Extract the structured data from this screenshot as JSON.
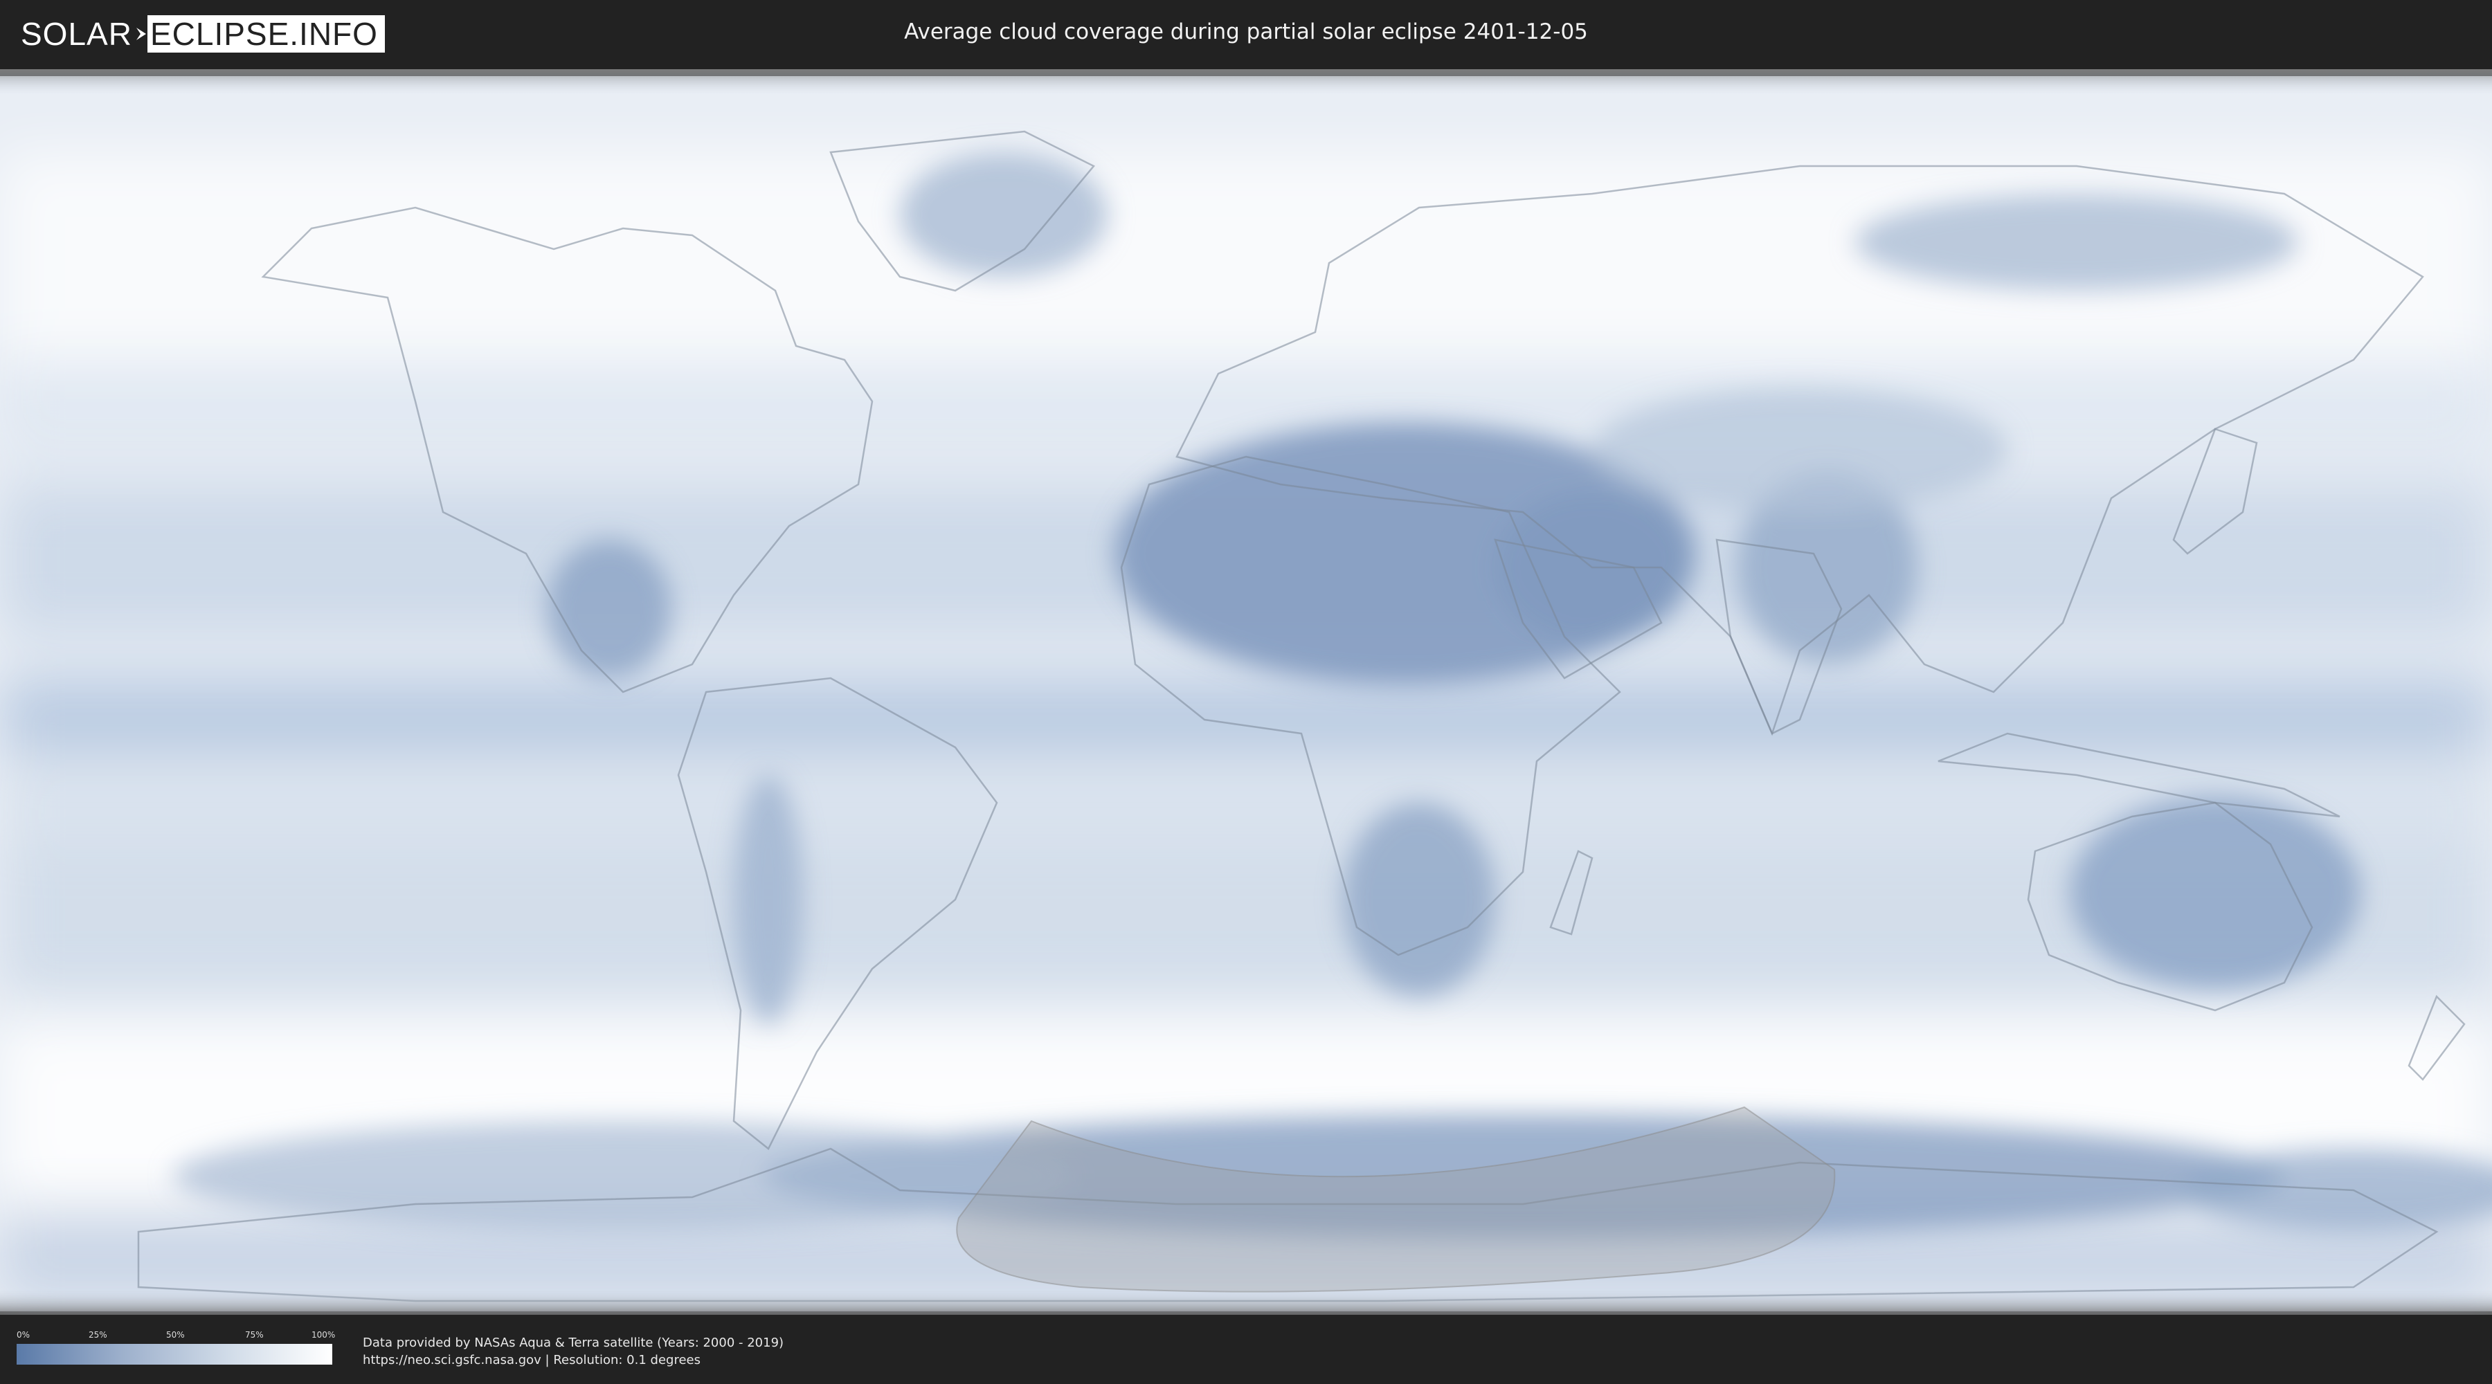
{
  "header": {
    "logo_left": "SOLAR",
    "logo_right": "ECLIPSE.INFO",
    "title": "Average cloud coverage during partial solar eclipse 2401-12-05"
  },
  "legend": {
    "ticks": [
      "0%",
      "25%",
      "50%",
      "75%",
      "100%"
    ],
    "colors": [
      "#5a7aa8",
      "#9db0cc",
      "#d0dbe8",
      "#ffffff"
    ]
  },
  "credits": {
    "line1": "Data provided by NASAs Aqua & Terra satellite (Years: 2000 - 2019)",
    "line2": "https://neo.sci.gsfc.nasa.gov | Resolution: 0.1 degrees"
  },
  "map": {
    "projection": "equirectangular",
    "layer": "average cloud coverage",
    "overlay": "partial eclipse visibility zone"
  }
}
